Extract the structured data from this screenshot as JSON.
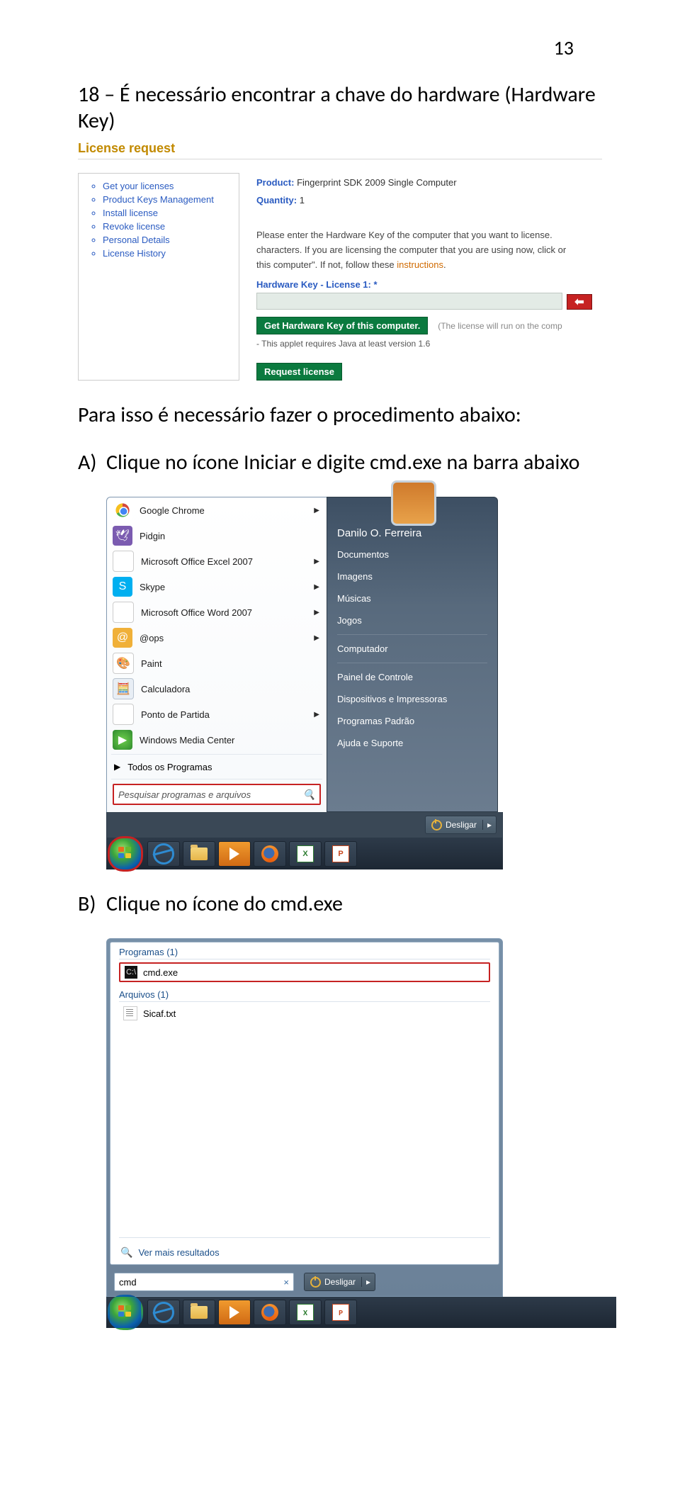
{
  "page": {
    "number": "13"
  },
  "doc": {
    "heading": "18 – É necessário encontrar a chave do hardware (Hardware Key)",
    "para_intro": "Para isso é necessário fazer o procedimento abaixo:",
    "step_a_prefix": "A)",
    "step_a_text": "Clique no ícone Iniciar e digite cmd.exe na barra abaixo",
    "step_b_prefix": "B)",
    "step_b_text": "Clique no ícone do cmd.exe"
  },
  "lic": {
    "title": "License request",
    "side_items": [
      "Get your licenses",
      "Product Keys Management",
      "Install license",
      "Revoke license",
      "Personal Details",
      "License History"
    ],
    "product_label": "Product:",
    "product_value": "Fingerprint SDK 2009 Single Computer",
    "quantity_label": "Quantity:",
    "quantity_value": "1",
    "instr_a": "Please enter the Hardware Key of the computer that you want to license. ",
    "instr_b": "characters. If you are licensing the computer that you are using now, click or",
    "instr_c": "this computer\". If not, follow these ",
    "instr_c_link": "instructions",
    "instr_c_end": ".",
    "hk_label": "Hardware Key - License 1: *",
    "btn_getkey": "Get Hardware Key of this computer.",
    "run_note": "(The license will run on the comp",
    "java_note": "- This applet requires Java at least version 1.6",
    "btn_request": "Request license"
  },
  "sm": {
    "left_items": [
      {
        "label": "Google Chrome",
        "icon": "chrome",
        "chev": true
      },
      {
        "label": "Pidgin",
        "icon": "pidgin",
        "chev": false
      },
      {
        "label": "Microsoft Office Excel 2007",
        "icon": "excel",
        "chev": true
      },
      {
        "label": "Skype",
        "icon": "skype",
        "chev": true
      },
      {
        "label": "Microsoft Office Word 2007",
        "icon": "word",
        "chev": true
      },
      {
        "label": "@ops",
        "icon": "ops",
        "chev": true
      },
      {
        "label": "Paint",
        "icon": "paint",
        "chev": false
      },
      {
        "label": "Calculadora",
        "icon": "calc",
        "chev": false
      },
      {
        "label": "Ponto de Partida",
        "icon": "flag",
        "chev": true
      },
      {
        "label": "Windows Media Center",
        "icon": "wmc",
        "chev": false
      }
    ],
    "all_programs": "Todos os Programas",
    "search_placeholder": "Pesquisar programas e arquivos",
    "right_user": "Danilo O. Ferreira",
    "right_links": [
      "Documentos",
      "Imagens",
      "Músicas",
      "Jogos",
      "Computador",
      "Painel de Controle",
      "Dispositivos e Impressoras",
      "Programas Padrão",
      "Ajuda e Suporte"
    ],
    "shutdown": "Desligar"
  },
  "sr": {
    "group_programs": "Programas (1)",
    "item_cmd": "cmd.exe",
    "group_files": "Arquivos (1)",
    "item_txt": "Sicaf.txt",
    "see_more": "Ver mais resultados",
    "search_value": "cmd",
    "shutdown": "Desligar"
  }
}
